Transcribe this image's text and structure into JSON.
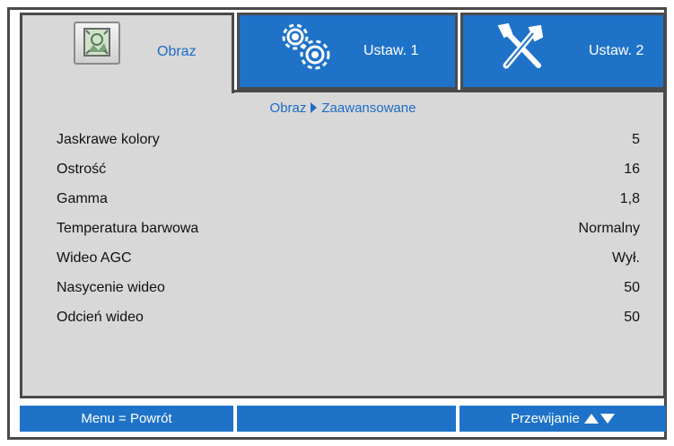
{
  "tabs": [
    {
      "label": "Obraz",
      "icon": "picture-icon",
      "active": true
    },
    {
      "label": "Ustaw. 1",
      "icon": "gears-icon",
      "active": false
    },
    {
      "label": "Ustaw. 2",
      "icon": "tools-icon",
      "active": false
    }
  ],
  "breadcrumb": {
    "parent": "Obraz",
    "current": "Zaawansowane"
  },
  "settings": [
    {
      "label": "Jaskrawe kolory",
      "value": "5"
    },
    {
      "label": "Ostrość",
      "value": "16"
    },
    {
      "label": "Gamma",
      "value": "1,8"
    },
    {
      "label": "Temperatura barwowa",
      "value": "Normalny"
    },
    {
      "label": "Wideo AGC",
      "value": "Wył."
    },
    {
      "label": "Nasycenie wideo",
      "value": "50"
    },
    {
      "label": "Odcień wideo",
      "value": "50"
    }
  ],
  "footer": {
    "menu_label": "Menu = Powrót",
    "middle_label": "",
    "scroll_label": "Przewijanie",
    "scroll_icons": [
      "arrow-up-icon",
      "arrow-down-icon"
    ]
  },
  "colors": {
    "accent": "#1e73c8",
    "panel": "#d8d8d8",
    "text_accent": "#1e6bc4"
  }
}
